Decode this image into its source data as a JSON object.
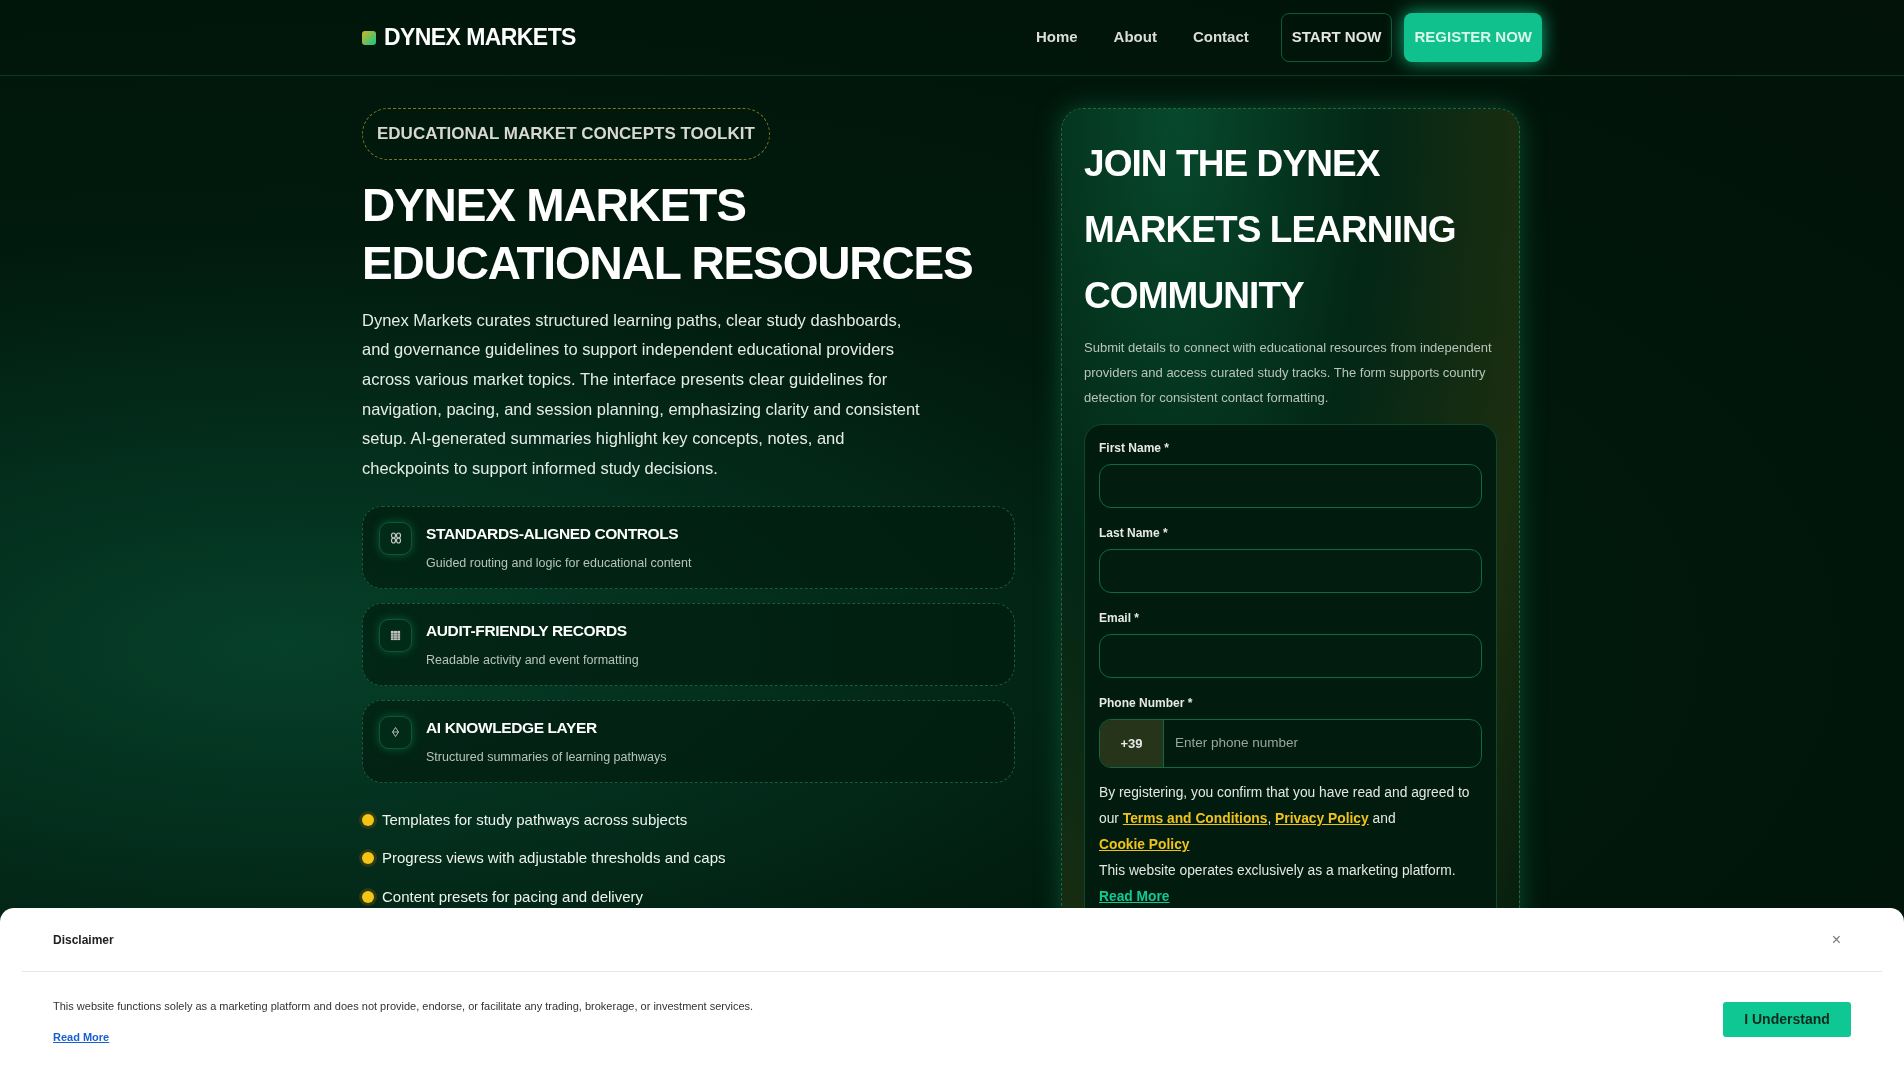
{
  "header": {
    "logo": "DYNEX MARKETS",
    "nav": [
      "Home",
      "About",
      "Contact"
    ],
    "start_button": "START NOW",
    "register_button": "REGISTER NOW"
  },
  "hero": {
    "badge": "EDUCATIONAL MARKET CONCEPTS TOOLKIT",
    "title": "DYNEX MARKETS EDUCATIONAL RESOURCES",
    "description": "Dynex Markets curates structured learning paths, clear study dashboards, and governance guidelines to support independent educational providers across various market topics. The interface presents clear guidelines for navigation, pacing, and session planning, emphasizing clarity and consistent setup. AI-generated summaries highlight key concepts, notes, and checkpoints to support informed study decisions.",
    "features": [
      {
        "kind": "links",
        "title": "STANDARDS-ALIGNED CONTROLS",
        "subtitle": "Guided routing and logic for educational content"
      },
      {
        "kind": "grid",
        "title": "AUDIT-FRIENDLY RECORDS",
        "subtitle": "Readable activity and event formatting"
      },
      {
        "kind": "diamond",
        "title": "AI KNOWLEDGE LAYER",
        "subtitle": "Structured summaries of learning pathways"
      }
    ],
    "bullets": [
      "Templates for study pathways across subjects",
      "Progress views with adjustable thresholds and caps",
      "Content presets for pacing and delivery"
    ]
  },
  "form": {
    "title": "JOIN THE DYNEX MARKETS LEARNING COMMUNITY",
    "description": "Submit details to connect with educational resources from independent providers and access curated study tracks. The form supports country detection for consistent contact formatting.",
    "fields": [
      {
        "kind": "text",
        "label": "First Name *"
      },
      {
        "kind": "text",
        "label": "Last Name *"
      },
      {
        "kind": "email",
        "label": "Email *"
      },
      {
        "kind": "phone",
        "label": "Phone Number *",
        "prefix": "+39",
        "placeholder": "Enter phone number"
      }
    ],
    "consent": [
      {
        "kind": "text",
        "text": "By registering, you confirm that you have read and agreed to our"
      },
      {
        "kind": "link",
        "text": "Terms and Conditions"
      },
      {
        "kind": "text",
        "text": ","
      },
      {
        "kind": "link",
        "text": "Privacy Policy"
      },
      {
        "kind": "text",
        "text": "and"
      },
      {
        "kind": "link",
        "text": "Cookie Policy"
      }
    ],
    "notice": "This website operates exclusively as a marketing platform.",
    "read_more": "Read More"
  },
  "disclaimer": {
    "title": "Disclaimer",
    "close": "×",
    "text": "This website functions solely as a marketing platform and does not provide, endorse, or facilitate any trading, brokerage, or investment services.",
    "link": "Read More",
    "button": "I Understand"
  }
}
